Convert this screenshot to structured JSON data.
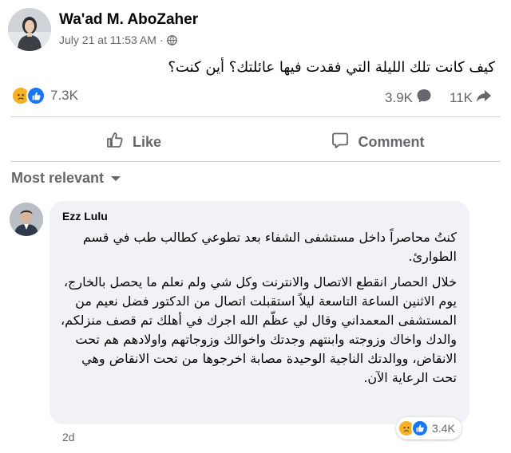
{
  "post": {
    "author": "Wa'ad M. AboZaher",
    "timestamp": "July 21 at 11:53 AM",
    "separator": "·",
    "privacy_icon": "globe-icon",
    "text": "كيف كانت تلك الليلة التي فقدت فيها عائلتك؟ أين كنت؟",
    "reaction_count": "7.3K",
    "comment_count": "3.9K",
    "share_count": "11K"
  },
  "actions": {
    "like_label": "Like",
    "comment_label": "Comment"
  },
  "sort": {
    "label": "Most relevant"
  },
  "comment": {
    "author": "Ezz Lulu",
    "paragraph1": "كنتُ محاصراً داخل مستشفى الشفاء بعد تطوعي كطالب طب في قسم الطوارئ.",
    "paragraph2": "خلال الحصار انقطع الاتصال والانترنت وكل شي ولم نعلم ما يحصل بالخارج، يوم الاثنين الساعة التاسعة ليلاً استقبلت اتصال من الدكتور فضل نعيم من المستشفى المعمداني وقال لي عظّم الله اجرك في أهلك تم قصف منزلكم، والدك واخاك وزوجته وابنتهم وجدتك واخوالك وزوجاتهم واولادهم هم تحت الانقاض، ووالدتك الناجية الوحيدة مصابة اخرجوها من تحت الانقاض وهي تحت الرعاية الآن.",
    "reaction_count": "3.4K",
    "age": "2d"
  },
  "colors": {
    "like_blue": "#1877f2",
    "sad_yellow": "#f7b125",
    "secondary_text": "#65676b",
    "bubble_bg": "#f0f2f5"
  }
}
